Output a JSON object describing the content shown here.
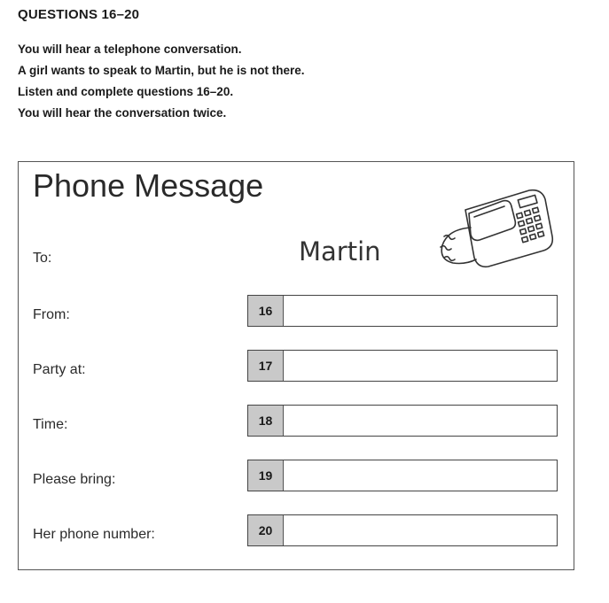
{
  "heading": "QUESTIONS 16–20",
  "instructions": [
    "You will hear a telephone conversation.",
    "A girl wants to speak to Martin, but he is not there.",
    "Listen and complete questions 16–20.",
    "You will hear the conversation twice."
  ],
  "form": {
    "title": "Phone Message",
    "to_label": "To:",
    "to_value": "Martin",
    "fields": [
      {
        "label": "From:",
        "number": "16"
      },
      {
        "label": "Party at:",
        "number": "17"
      },
      {
        "label": "Time:",
        "number": "18"
      },
      {
        "label": "Please bring:",
        "number": "19"
      },
      {
        "label": "Her phone number:",
        "number": "20"
      }
    ]
  }
}
